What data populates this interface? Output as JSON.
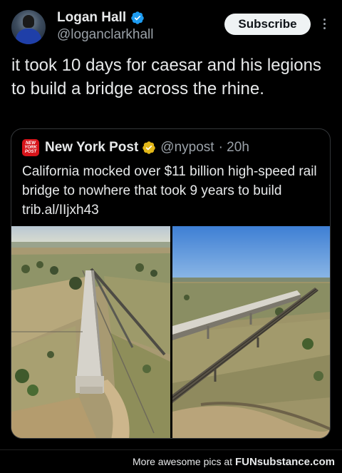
{
  "author": {
    "name": "Logan Hall",
    "handle": "@loganclarkhall"
  },
  "subscribe_label": "Subscribe",
  "tweet_text": "it took 10 days for caesar and his legions to build a bridge across the rhine.",
  "quoted": {
    "logo_text": "NEW YORK POST",
    "name": "New York Post",
    "handle": "@nypost",
    "time": "· 20h",
    "text": "California mocked over $11 billion high-speed rail bridge to nowhere that took 9 years to build trib.al/IIjxh43"
  },
  "footer": {
    "prefix": "More awesome pics at ",
    "brand": "FUNsubstance.com"
  },
  "colors": {
    "background": "#000000",
    "verified_blue": "#1d9bf0",
    "affiliate_gold": "#e2b719",
    "nypost_red": "#d7141a"
  },
  "icons": [
    "verified-badge-icon",
    "gold-verified-badge-icon",
    "more-options-icon"
  ]
}
